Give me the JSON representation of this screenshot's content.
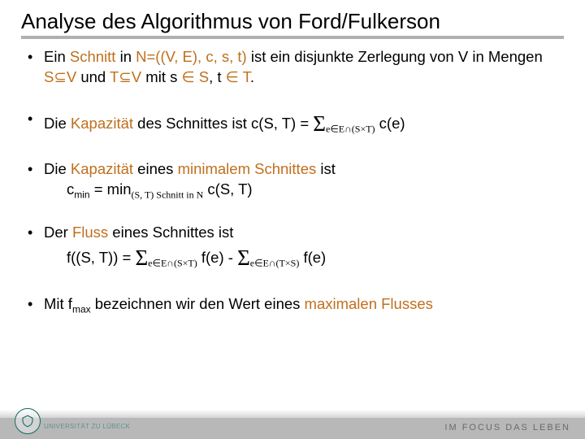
{
  "title": "Analyse des Algorithmus von Ford/Fulkerson",
  "bullets": {
    "b1_a": "Ein ",
    "b1_schnitt": "Schnitt",
    "b1_b": " in ",
    "b1_net": "N=((V, E), c, s, t)",
    "b1_c": " ist ein disjunkte Zerlegung von V in Mengen ",
    "b1_S": "S⊆V",
    "b1_d": " und ",
    "b1_T": "T⊆V",
    "b1_e": " mit s ",
    "b1_inS": "∈ S",
    "b1_f": ", t ",
    "b1_inT": "∈ T",
    "b1_g": ".",
    "b2_a": "Die ",
    "b2_kap": "Kapazität",
    "b2_b": " des Schnittes ist c(S, T) = ",
    "b2_idx": "e∈E∩(S×T)",
    "b2_c": " c(e)",
    "b3_a": "Die ",
    "b3_kap": "Kapazität",
    "b3_b": " eines ",
    "b3_min": "minimalem Schnittes",
    "b3_c": " ist",
    "b3_line2a": "c",
    "b3_line2min": "min",
    "b3_line2b": " = min",
    "b3_line2idx": "(S, T) Schnitt in N",
    "b3_line2c": " c(S, T)",
    "b4_a": "Der ",
    "b4_fluss": "Fluss",
    "b4_b": " eines Schnittes ist",
    "b4_line2a": "f((S, T)) = ",
    "b4_idx1": "e∈E∩(S×T)",
    "b4_mid": " f(e)  -  ",
    "b4_idx2": "e∈E∩(T×S)",
    "b4_end": " f(e)",
    "b5_a": "Mit f",
    "b5_max": "max",
    "b5_b": " bezeichnen wir den Wert eines ",
    "b5_hl": "maximalen Flusses",
    "crest_txt": "UNIVERSITÄT ZU LÜBECK",
    "tagline": "IM FOCUS DAS LEBEN"
  }
}
